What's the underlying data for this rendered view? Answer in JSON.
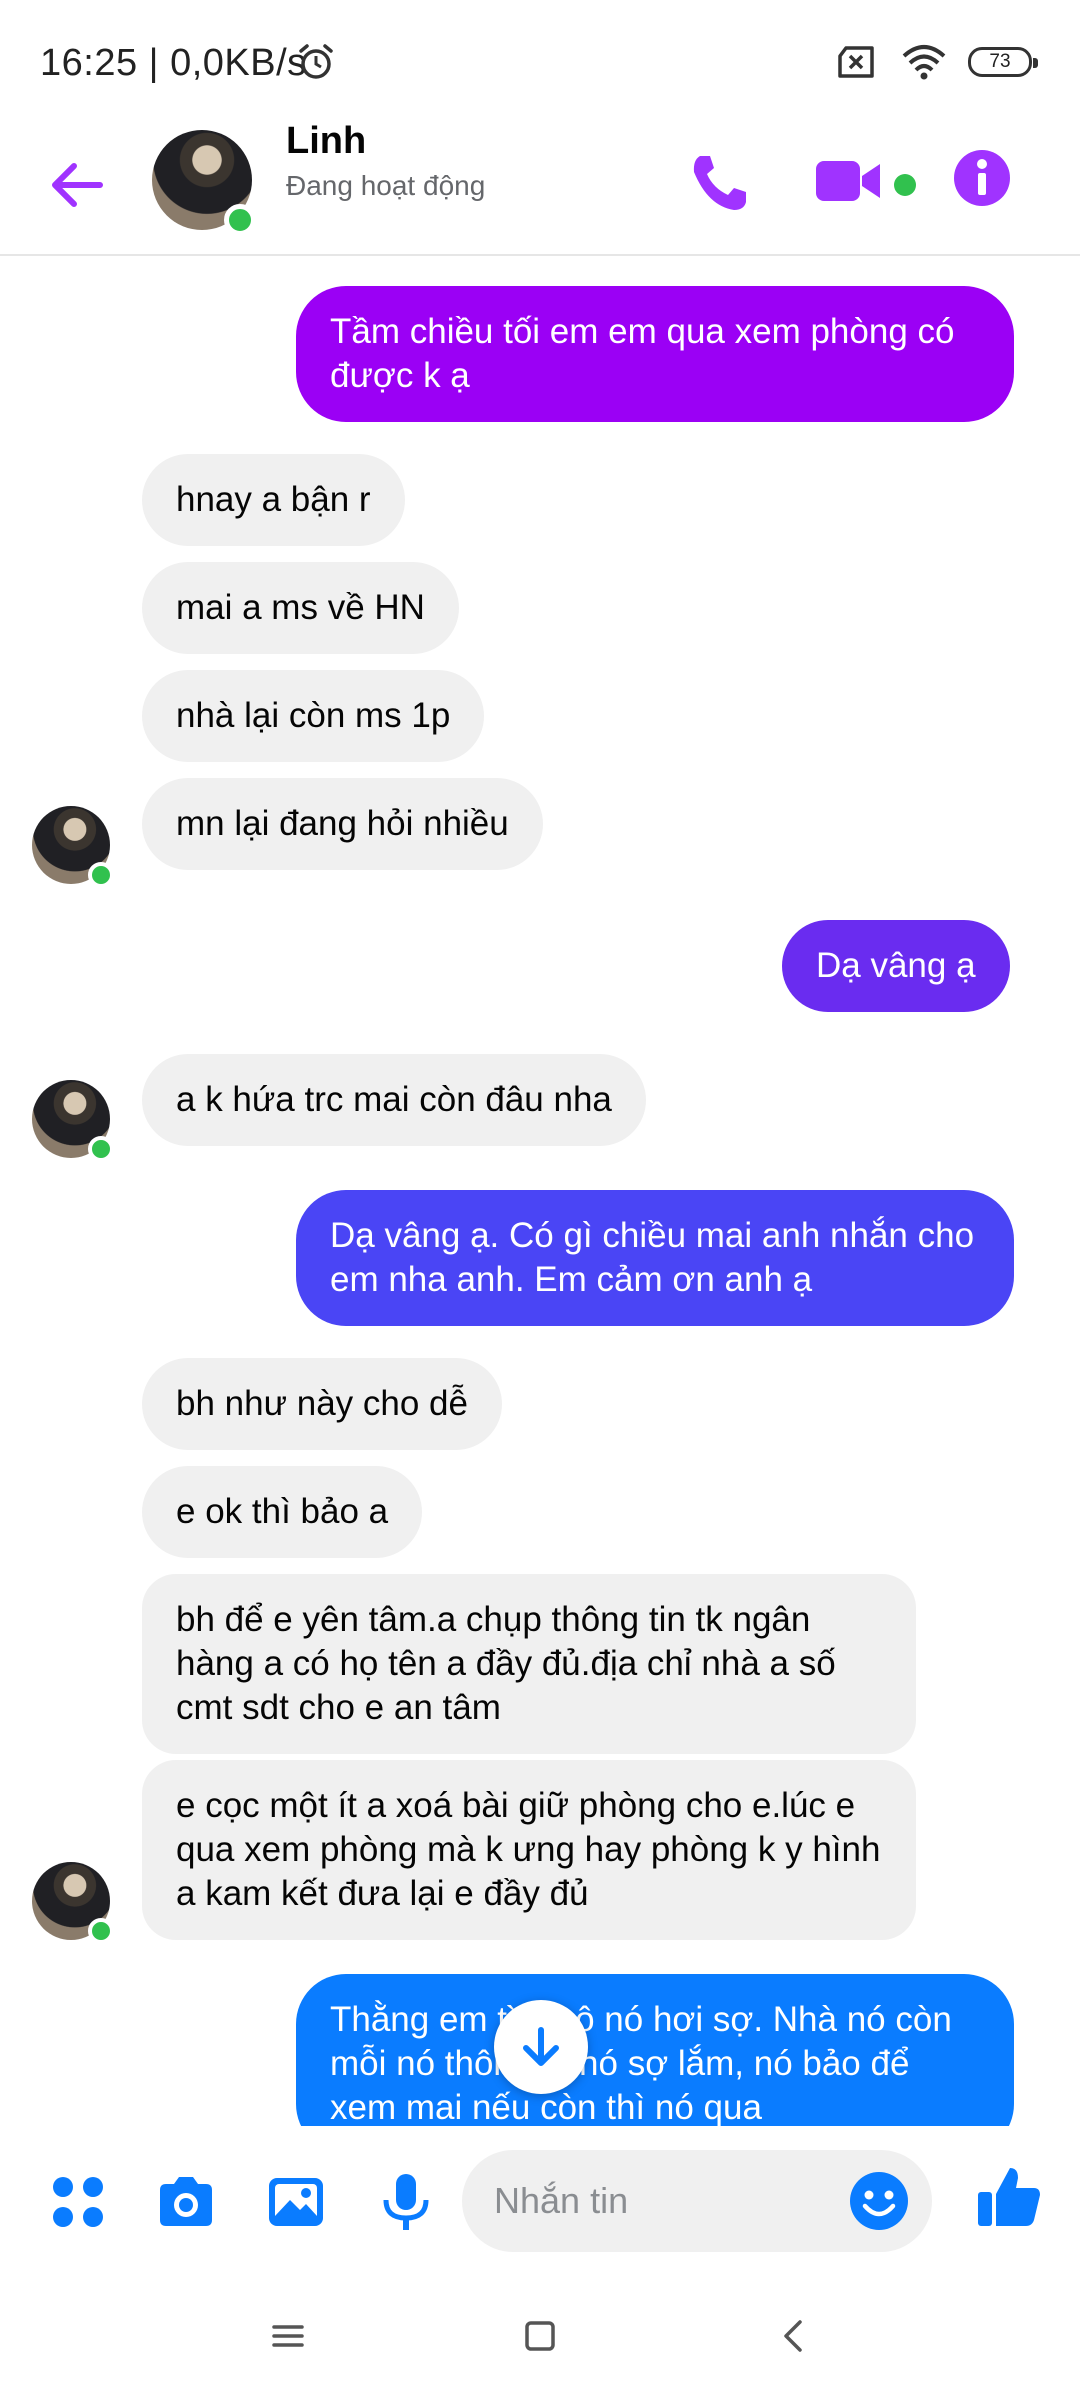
{
  "status_bar": {
    "time_speed": "16:25 | 0,0KB/s",
    "battery": "73"
  },
  "header": {
    "contact_name": "Linh",
    "contact_status": "Đang hoạt động",
    "accent_color": "#a033ff",
    "online_color": "#31c14e"
  },
  "messages": [
    {
      "from": "me",
      "text": "Tầm chiều tối em em qua xem phòng có được k ạ",
      "color": "#9b00f5"
    },
    {
      "from": "them",
      "text": "hnay a bận r"
    },
    {
      "from": "them",
      "text": "mai a ms về HN"
    },
    {
      "from": "them",
      "text": "nhà lại còn ms 1p"
    },
    {
      "from": "them",
      "text": "mn lại đang hỏi nhiều"
    },
    {
      "from": "me",
      "text": "Dạ vâng ạ",
      "color": "#6a2cf0"
    },
    {
      "from": "them",
      "text": "a k hứa trc mai còn đâu nha"
    },
    {
      "from": "me",
      "text": "Dạ vâng ạ. Có gì chiều mai anh nhắn cho em nha anh. Em cảm ơn anh ạ",
      "color": "#4a45f5"
    },
    {
      "from": "them",
      "text": "bh như này cho dễ"
    },
    {
      "from": "them",
      "text": "e ok thì bảo a"
    },
    {
      "from": "them",
      "text": "bh để e yên tâm.a chụp thông tin tk ngân hàng a có họ tên a đầy đủ.địa chỉ nhà a số cmt sdt cho e an tâm"
    },
    {
      "from": "them",
      "text": "e cọc một ít a xoá bài giữ phòng cho e.lúc e qua xem phòng mà k ưng hay phòng k y hình a kam kết đưa lại e đầy đủ"
    },
    {
      "from": "me",
      "text": "Thằng em tìm hộ nó hơi sợ. Nhà nó còn mỗi nó thôi nên nó sợ lắm, nó bảo để xem mai nếu còn thì nó qua",
      "color": "#0a7cff"
    }
  ],
  "composer": {
    "placeholder": "Nhắn tin",
    "icons": [
      "apps-icon",
      "camera-icon",
      "image-icon",
      "microphone-icon",
      "emoji-icon",
      "thumbs-up-icon"
    ]
  }
}
